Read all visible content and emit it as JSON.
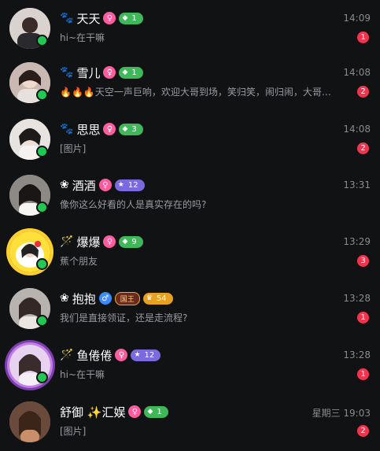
{
  "conversations": [
    {
      "prefix": "🐾",
      "name": "天天",
      "gender": "♀",
      "level": "1",
      "level_color": "green",
      "time": "14:09",
      "message": "hi~在干嘛",
      "unread": "1"
    },
    {
      "prefix": "🐾",
      "name": "雪儿",
      "gender": "♀",
      "level": "1",
      "level_color": "green",
      "time": "14:08",
      "message": "🔥🔥🔥天空一声巨响，欢迎大哥到场，笑归笑，闹归闹，大哥…",
      "unread": "2"
    },
    {
      "prefix": "🐾",
      "name": "思思",
      "gender": "♀",
      "level": "3",
      "level_color": "green",
      "time": "14:08",
      "message": "[图片]",
      "unread": "2"
    },
    {
      "prefix": "❀",
      "name": "酒酒",
      "gender": "♀",
      "level": "12",
      "level_color": "purple",
      "time": "13:31",
      "message": "像你这么好看的人是真实存在的吗?",
      "unread": ""
    },
    {
      "prefix": "🪄",
      "name": "爆爆",
      "gender": "♀",
      "level": "9",
      "level_color": "green",
      "time": "13:29",
      "message": "蕉个朋友",
      "unread": "3"
    },
    {
      "prefix": "❀",
      "name": "抱抱",
      "gender": "♂",
      "level": "54",
      "level_color": "gold",
      "crown": "国王",
      "time": "13:28",
      "message": "我们是直接领证，还是走流程?",
      "unread": "1"
    },
    {
      "prefix": "🪄",
      "name": "鱼倦倦",
      "gender": "♀",
      "level": "12",
      "level_color": "purple",
      "time": "13:28",
      "message": "hi~在干嘛",
      "unread": "1"
    },
    {
      "prefix": "",
      "name": "舒御 ✨汇娱",
      "gender": "♀",
      "level": "1",
      "level_color": "green",
      "time": "星期三 19:03",
      "message": "[图片]",
      "unread": "2"
    }
  ]
}
